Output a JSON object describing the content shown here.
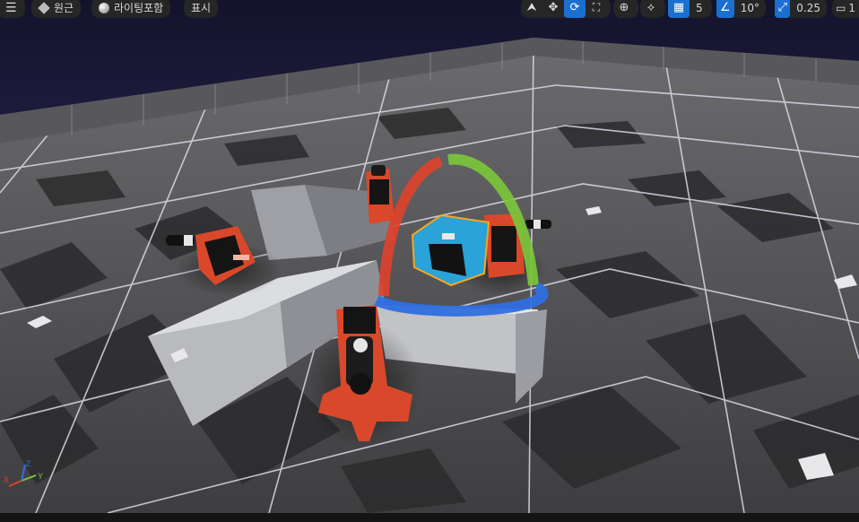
{
  "toolbar": {
    "menu_icon": "hamburger-menu-icon",
    "perspective_label": "원근",
    "lighting_label": "라이팅포함",
    "show_label": "표시",
    "grid_snap_value": "5",
    "rotation_snap_value": "10°",
    "scale_snap_value": "0.25",
    "camera_speed_value": "1"
  },
  "colors": {
    "active_blue": "#1a6fd1",
    "toolbar_bg": "#262626",
    "selection_orange": "#f6a623",
    "robot_orange": "#d9482a",
    "gizmo_red": "#e0412b",
    "gizmo_green": "#7cc83a",
    "gizmo_blue": "#2f6fe0"
  },
  "axis_indicator": {
    "x_label": "X",
    "y_label": "Y",
    "z_label": "Z"
  }
}
